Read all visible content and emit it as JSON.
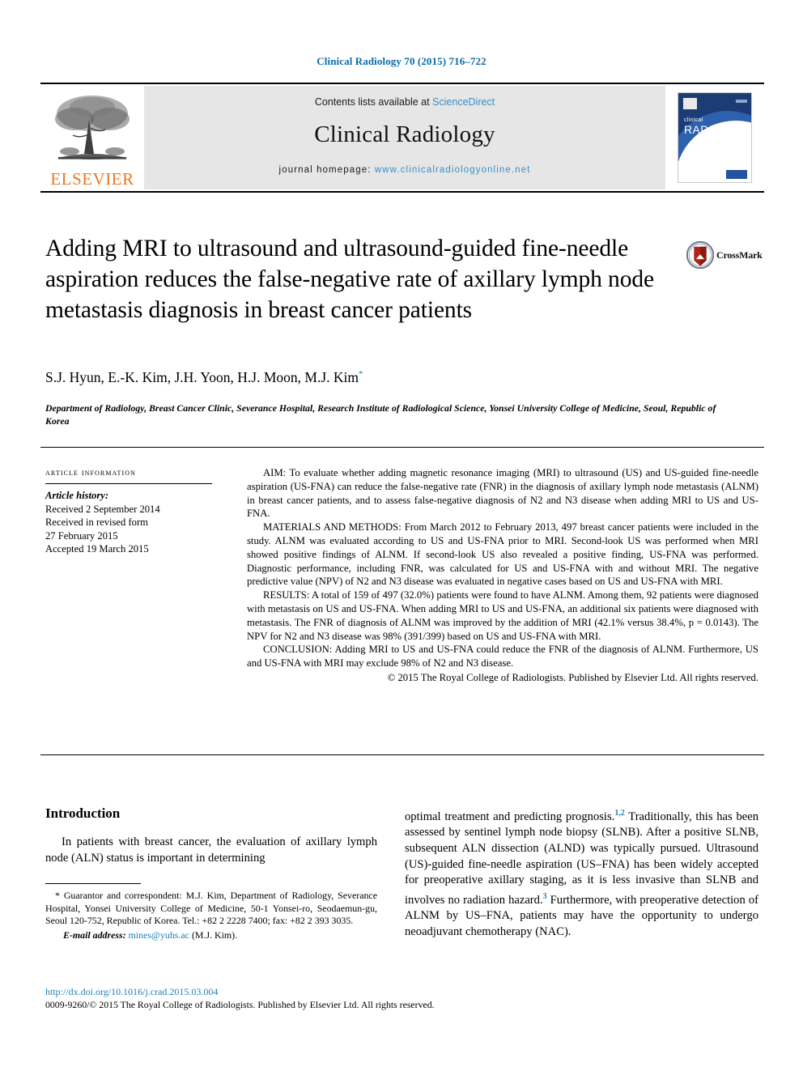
{
  "running_head": "Clinical Radiology 70 (2015) 716–722",
  "masthead": {
    "publisher_word": "ELSEVIER",
    "contents_prefix": "Contents lists available at ",
    "contents_link": "ScienceDirect",
    "journal_name": "Clinical Radiology",
    "homepage_prefix": "journal homepage: ",
    "homepage_url": "www.clinicalradiologyonline.net",
    "cover": {
      "line1": "clinical",
      "line2": "RADIOLOGY"
    }
  },
  "article": {
    "title": "Adding MRI to ultrasound and ultrasound-guided fine-needle aspiration reduces the false-negative rate of axillary lymph node metastasis diagnosis in breast cancer patients",
    "crossmark_label": "CrossMark",
    "authors": "S.J. Hyun, E.-K. Kim, J.H. Yoon, H.J. Moon, M.J. Kim",
    "author_correspondence_marker": "*",
    "affiliation": "Department of Radiology, Breast Cancer Clinic, Severance Hospital, Research Institute of Radiological Science, Yonsei University College of Medicine, Seoul, Republic of Korea"
  },
  "article_info": {
    "heading": "ARTICLE INFORMATION",
    "history_label": "Article history:",
    "received": "Received 2 September 2014",
    "revised_label": "Received in revised form",
    "revised_date": "27 February 2015",
    "accepted": "Accepted 19 March 2015"
  },
  "abstract": {
    "aim": "AIM: To evaluate whether adding magnetic resonance imaging (MRI) to ultrasound (US) and US-guided fine-needle aspiration (US-FNA) can reduce the false-negative rate (FNR) in the diagnosis of axillary lymph node metastasis (ALNM) in breast cancer patients, and to assess false-negative diagnosis of N2 and N3 disease when adding MRI to US and US-FNA.",
    "materials": "MATERIALS AND METHODS: From March 2012 to February 2013, 497 breast cancer patients were included in the study. ALNM was evaluated according to US and US-FNA prior to MRI. Second-look US was performed when MRI showed positive findings of ALNM. If second-look US also revealed a positive finding, US-FNA was performed. Diagnostic performance, including FNR, was calculated for US and US-FNA with and without MRI. The negative predictive value (NPV) of N2 and N3 disease was evaluated in negative cases based on US and US-FNA with MRI.",
    "results": "RESULTS: A total of 159 of 497 (32.0%) patients were found to have ALNM. Among them, 92 patients were diagnosed with metastasis on US and US-FNA. When adding MRI to US and US-FNA, an additional six patients were diagnosed with metastasis. The FNR of diagnosis of ALNM was improved by the addition of MRI (42.1% versus 38.4%, p = 0.0143). The NPV for N2 and N3 disease was 98% (391/399) based on US and US-FNA with MRI.",
    "conclusion": "CONCLUSION: Adding MRI to US and US-FNA could reduce the FNR of the diagnosis of ALNM. Furthermore, US and US-FNA with MRI may exclude 98% of N2 and N3 disease.",
    "copyright": "© 2015 The Royal College of Radiologists. Published by Elsevier Ltd. All rights reserved."
  },
  "body": {
    "intro_heading": "Introduction",
    "intro_left": "In patients with breast cancer, the evaluation of axillary lymph node (ALN) status is important in determining",
    "intro_right_1": "optimal treatment and predicting prognosis.",
    "intro_right_ref1": "1,2",
    "intro_right_2": " Traditionally, this has been assessed by sentinel lymph node biopsy (SLNB). After a positive SLNB, subsequent ALN dissection (ALND) was typically pursued. Ultrasound (US)-guided fine-needle aspiration (US–FNA) has been widely accepted for preoperative axillary staging, as it is less invasive than SLNB and involves no radiation hazard.",
    "intro_right_ref2": "3",
    "intro_right_3": " Furthermore, with preoperative detection of ALNM by US–FNA, patients may have the opportunity to undergo neoadjuvant chemotherapy (NAC)."
  },
  "footnotes": {
    "correspondence": "* Guarantor and correspondent: M.J. Kim, Department of Radiology, Severance Hospital, Yonsei University College of Medicine, 50-1 Yonsei-ro, Seodaemun-gu, Seoul 120-752, Republic of Korea. Tel.: +82 2 2228 7400; fax: +82 2 393 3035.",
    "email_label": "E-mail address:",
    "email": "mines@yuhs.ac",
    "email_owner": "(M.J. Kim).",
    "doi": "http://dx.doi.org/10.1016/j.crad.2015.03.004",
    "copyright": "0009-9260/© 2015 The Royal College of Radiologists. Published by Elsevier Ltd. All rights reserved."
  },
  "colors": {
    "link_blue": "#1b7fb8",
    "elsevier_orange": "#E87722",
    "banner_gray": "#e6e6e6"
  }
}
